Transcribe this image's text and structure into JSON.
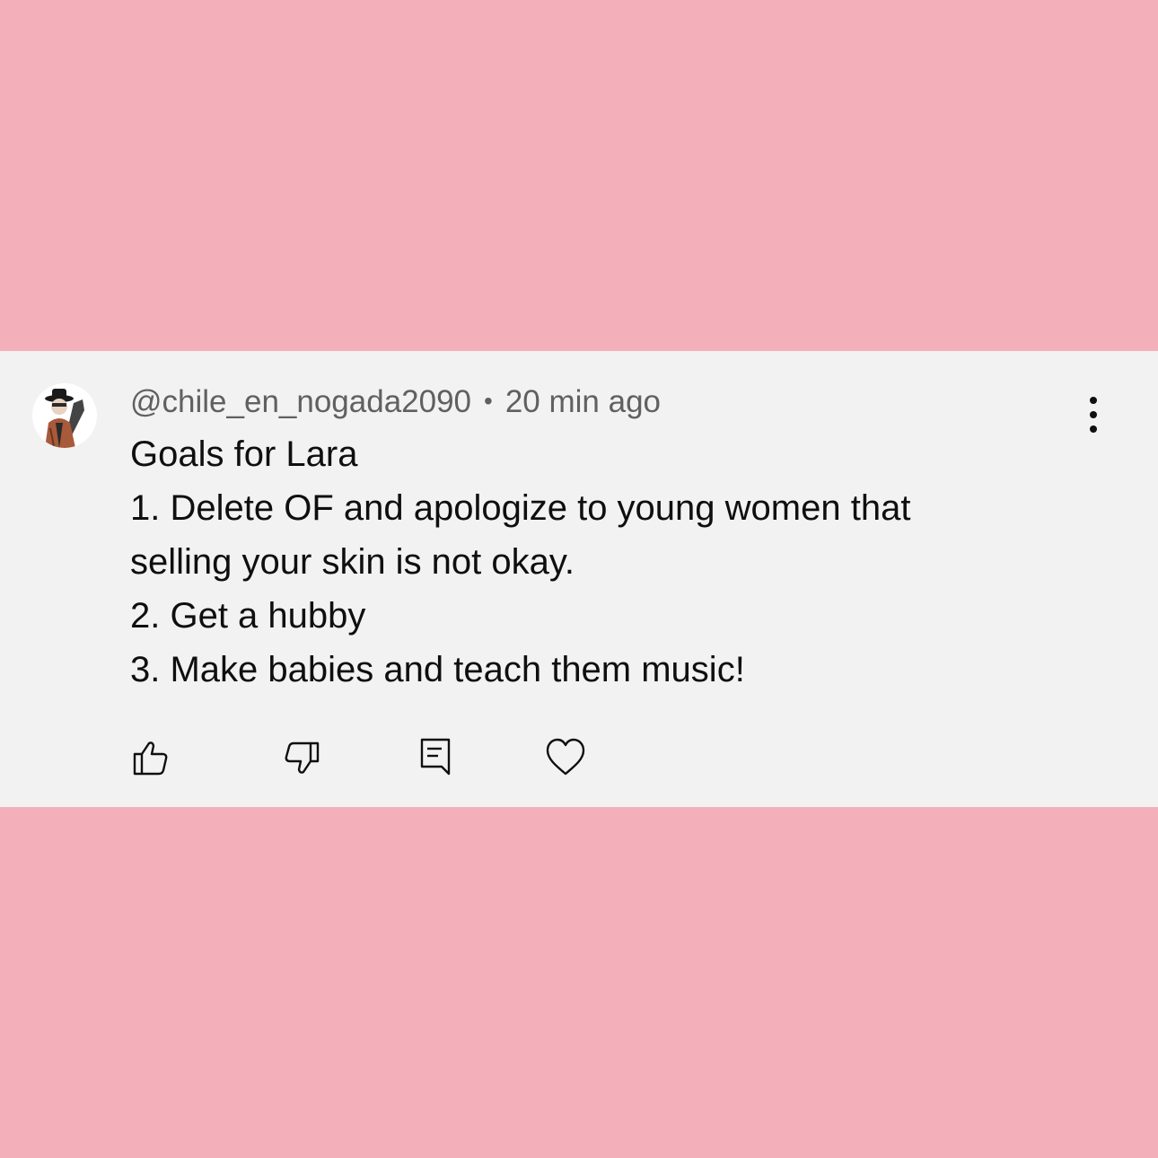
{
  "comment": {
    "username": "@chile_en_nogada2090",
    "separator": "•",
    "timestamp": "20 min ago",
    "lines": [
      "Goals for Lara",
      "1. Delete OF and apologize to young women that",
      "selling your skin is not okay.",
      "2. Get a hubby",
      "3. Make babies and teach them music!"
    ]
  },
  "actions": {
    "like_icon": "thumbs-up-icon",
    "dislike_icon": "thumbs-down-icon",
    "reply_icon": "reply-comment-icon",
    "heart_icon": "heart-icon",
    "more_icon": "vertical-ellipsis-icon"
  },
  "colors": {
    "background": "#f3b0bb",
    "card": "#f2f2f2",
    "meta_text": "#606060",
    "body_text": "#0f0f0f"
  }
}
